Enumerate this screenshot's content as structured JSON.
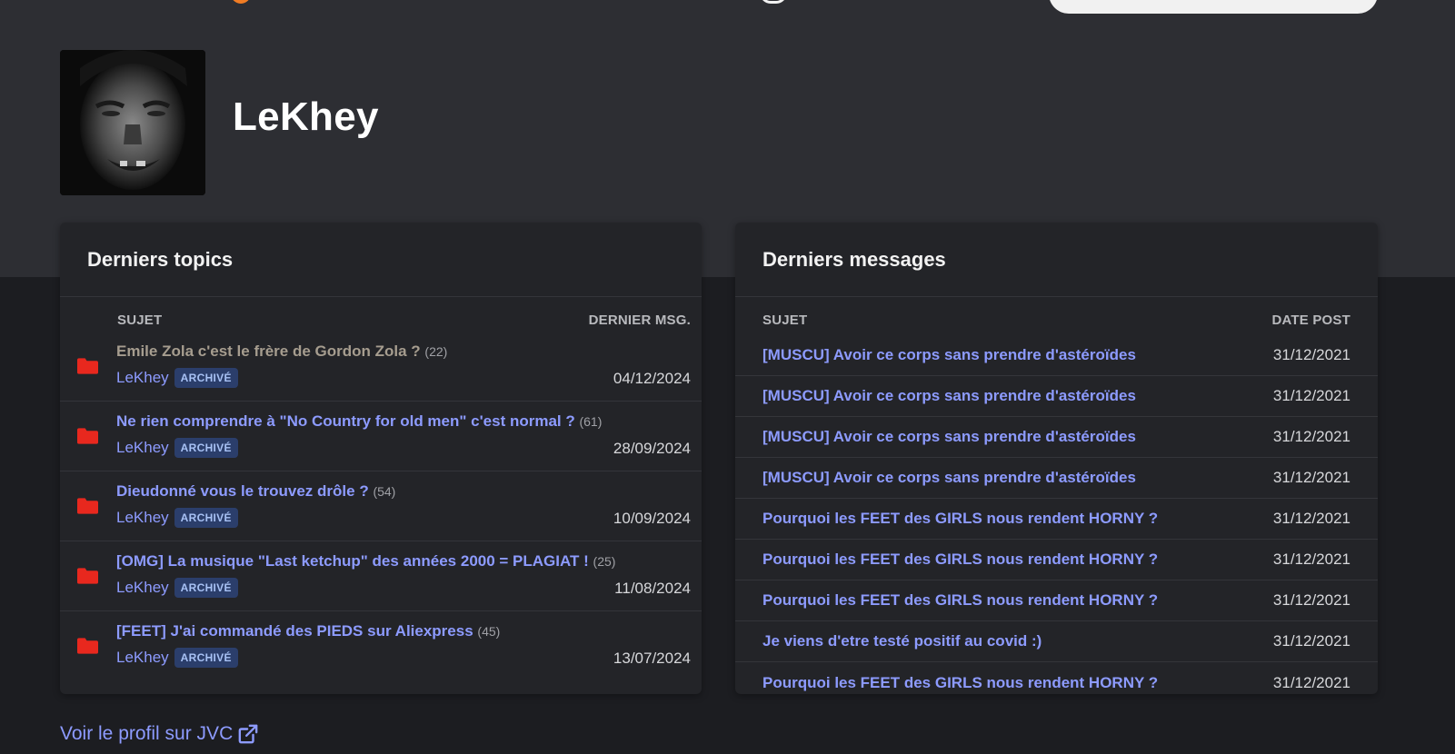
{
  "header": {
    "accent_orange": "#f07c24",
    "search_placeholder": ""
  },
  "profile": {
    "username": "LeKhey",
    "avatar_icon": "profile-photo"
  },
  "topics_card": {
    "title": "Derniers topics",
    "col_subject": "SUJET",
    "col_last": "DERNIER MSG.",
    "items": [
      {
        "title": "Emile Zola c'est le frère de Gordon Zola ?",
        "count": "(22)",
        "author": "LeKhey",
        "badge": "ARCHIVÉ",
        "date": "04/12/2024"
      },
      {
        "title": "Ne rien comprendre à \"No Country for old men\" c'est normal ?",
        "count": "(61)",
        "author": "LeKhey",
        "badge": "ARCHIVÉ",
        "date": "28/09/2024"
      },
      {
        "title": "Dieudonné vous le trouvez drôle ?",
        "count": "(54)",
        "author": "LeKhey",
        "badge": "ARCHIVÉ",
        "date": "10/09/2024"
      },
      {
        "title": "[OMG] La musique \"Last ketchup\" des années 2000 = PLAGIAT !",
        "count": "(25)",
        "author": "LeKhey",
        "badge": "ARCHIVÉ",
        "date": "11/08/2024"
      },
      {
        "title": "[FEET] J'ai commandé des PIEDS sur Aliexpress",
        "count": "(45)",
        "author": "LeKhey",
        "badge": "ARCHIVÉ",
        "date": "13/07/2024"
      }
    ]
  },
  "messages_card": {
    "title": "Derniers messages",
    "col_subject": "SUJET",
    "col_date": "DATE POST",
    "items": [
      {
        "title": "[MUSCU] Avoir ce corps sans prendre d'astéroïdes",
        "date": "31/12/2021"
      },
      {
        "title": "[MUSCU] Avoir ce corps sans prendre d'astéroïdes",
        "date": "31/12/2021"
      },
      {
        "title": "[MUSCU] Avoir ce corps sans prendre d'astéroïdes",
        "date": "31/12/2021"
      },
      {
        "title": "[MUSCU] Avoir ce corps sans prendre d'astéroïdes",
        "date": "31/12/2021"
      },
      {
        "title": "Pourquoi les FEET des GIRLS nous rendent HORNY ?",
        "date": "31/12/2021"
      },
      {
        "title": "Pourquoi les FEET des GIRLS nous rendent HORNY ?",
        "date": "31/12/2021"
      },
      {
        "title": "Pourquoi les FEET des GIRLS nous rendent HORNY ?",
        "date": "31/12/2021"
      },
      {
        "title": "Je viens d'etre testé positif au covid :)",
        "date": "31/12/2021"
      },
      {
        "title": "Pourquoi les FEET des GIRLS nous rendent HORNY ?",
        "date": "31/12/2021"
      }
    ]
  },
  "footer": {
    "jvc_link": "Voir le profil sur JVC",
    "jvc_icon": "external-link-icon"
  },
  "colors": {
    "link": "#8d9bff",
    "folder": "#e8281e",
    "badge_bg": "#2b3e6b"
  }
}
